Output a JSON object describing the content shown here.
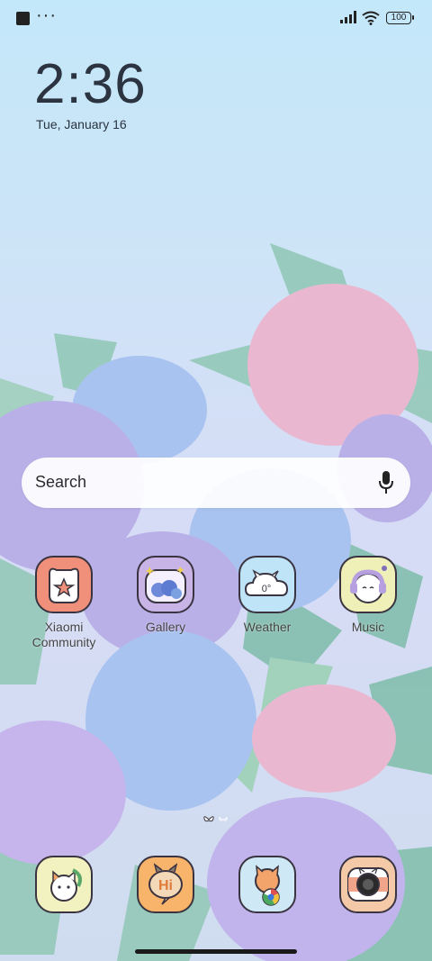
{
  "status_bar": {
    "battery": "100",
    "icons": [
      "notification-square-icon",
      "more-dots-icon",
      "signal-icon",
      "wifi-icon",
      "battery-icon"
    ]
  },
  "lockscreen": {
    "time": "2:36",
    "date": "Tue, January 16"
  },
  "search": {
    "placeholder": "Search",
    "icon": "microphone-icon"
  },
  "apps": [
    {
      "label": "Xiaomi\nCommunity",
      "color": "#f0907a"
    },
    {
      "label": "Gallery",
      "color": "#c9b4e8"
    },
    {
      "label": "Weather",
      "color": "#bfe3f7"
    },
    {
      "label": "Music",
      "color": "#eef0b8"
    }
  ],
  "dock": [
    {
      "label": "",
      "color": "#f2f1c0"
    },
    {
      "label": "Hi",
      "color": "#f7b46a"
    },
    {
      "label": "",
      "color": "#cfe8f5"
    },
    {
      "label": "",
      "color": "#f3c9a8"
    }
  ],
  "weather_icon_text": "0°",
  "colors": {
    "hydrangea_purple": "#b9b0e8",
    "hydrangea_blue": "#a9c3f0",
    "hydrangea_pink": "#e9b8d0",
    "leaf": "#8fc7b4"
  }
}
